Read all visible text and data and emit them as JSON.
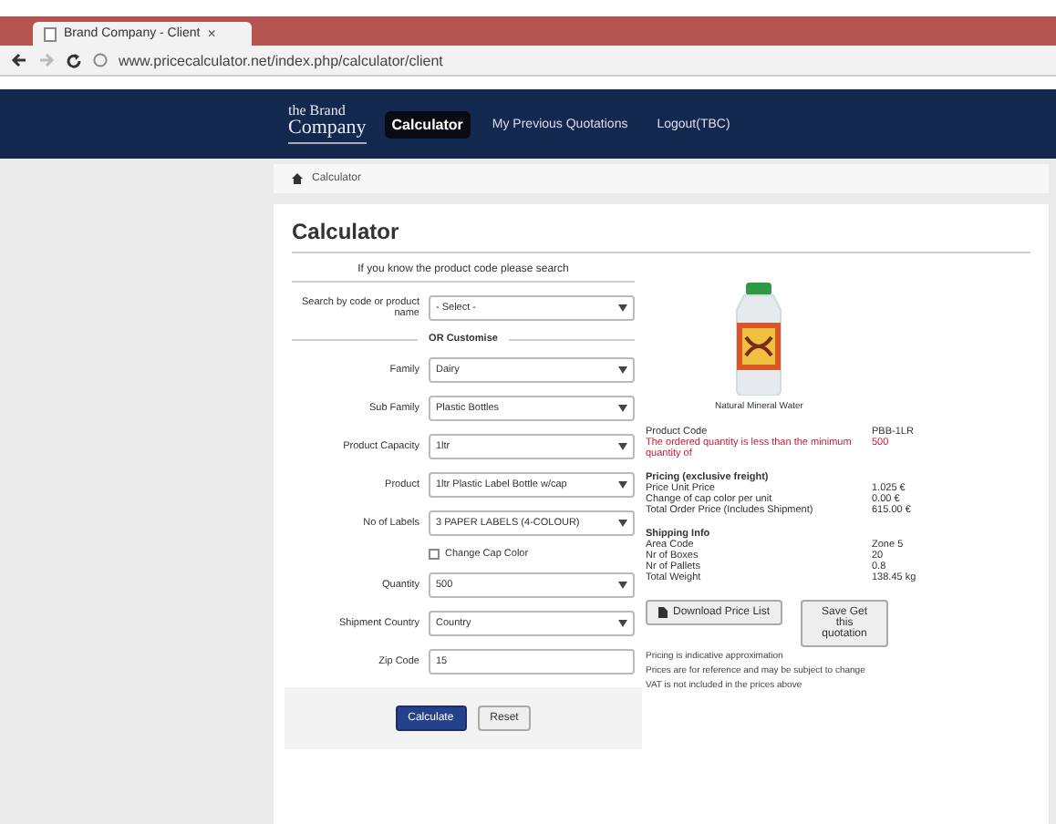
{
  "browser": {
    "tab_title": "Brand Company - Client",
    "tab_close": "×",
    "url": "www.pricecalculator.net/index.php/calculator/client"
  },
  "header": {
    "logo_top": "the Brand",
    "logo_bottom": "Company",
    "nav": [
      {
        "label": "Calculator",
        "selected": true
      },
      {
        "label": "My Previous Quotations",
        "selected": false
      },
      {
        "label": "Logout(TBC)",
        "selected": false
      }
    ]
  },
  "breadcrumb": "Calculator",
  "page_title": "Calculator",
  "form": {
    "intro": "If you know the product code please search",
    "search": {
      "label": "Search by code or product name",
      "value": "- Select -"
    },
    "divider": "OR Customise",
    "fields": [
      {
        "kind": "select",
        "label": "Family",
        "value": "Dairy"
      },
      {
        "kind": "select",
        "label": "Sub Family",
        "value": "Plastic Bottles"
      },
      {
        "kind": "select",
        "label": "Product Capacity",
        "value": "1ltr"
      },
      {
        "kind": "select",
        "label": "Product",
        "value": "1ltr Plastic Label Bottle w/cap"
      },
      {
        "kind": "select",
        "label": "No of Labels",
        "value": "3 PAPER LABELS (4-COLOUR)"
      },
      {
        "kind": "checkbox",
        "label": "Change Cap Color",
        "checked": false
      },
      {
        "kind": "select",
        "label": "Quantity",
        "value": "500"
      },
      {
        "kind": "select",
        "label": "Shipment Country",
        "value": "Country"
      },
      {
        "kind": "text",
        "label": "Zip Code",
        "value": "15"
      }
    ],
    "buttons": [
      {
        "label": "Calculate",
        "primary": true
      },
      {
        "label": "Reset",
        "primary": false
      }
    ]
  },
  "result": {
    "image_caption": "Natural Mineral Water",
    "groups": [
      {
        "rows": [
          {
            "label": "Product Code",
            "value": "PBB-1LR",
            "warning": false
          },
          {
            "label": "The ordered quantity is less than the minimum quantity of",
            "value": "500",
            "warning": true
          }
        ]
      },
      {
        "title": "Pricing (exclusive freight)",
        "rows": [
          {
            "label": "Price Unit Price",
            "value": "1.025 €",
            "warning": false
          },
          {
            "label": "Change of cap color per unit",
            "value": "0.00 €",
            "warning": false
          },
          {
            "label": "Total Order Price (Includes Shipment)",
            "value": "615.00 €",
            "warning": false
          }
        ]
      },
      {
        "title": "Shipping Info",
        "rows": [
          {
            "label": "Area Code",
            "value": "Zone 5",
            "warning": false
          },
          {
            "label": "Nr of Boxes",
            "value": "20",
            "warning": false
          },
          {
            "label": "Nr of Pallets",
            "value": "0.8",
            "warning": false
          },
          {
            "label": "Total Weight",
            "value": "138.45 kg",
            "warning": false
          }
        ]
      }
    ],
    "download": "Download Price List",
    "save": "Save Get this quotation",
    "notes": [
      "Pricing is indicative approximation",
      "Prices are for reference and may be subject to change",
      "VAT is not included in the prices above"
    ]
  }
}
